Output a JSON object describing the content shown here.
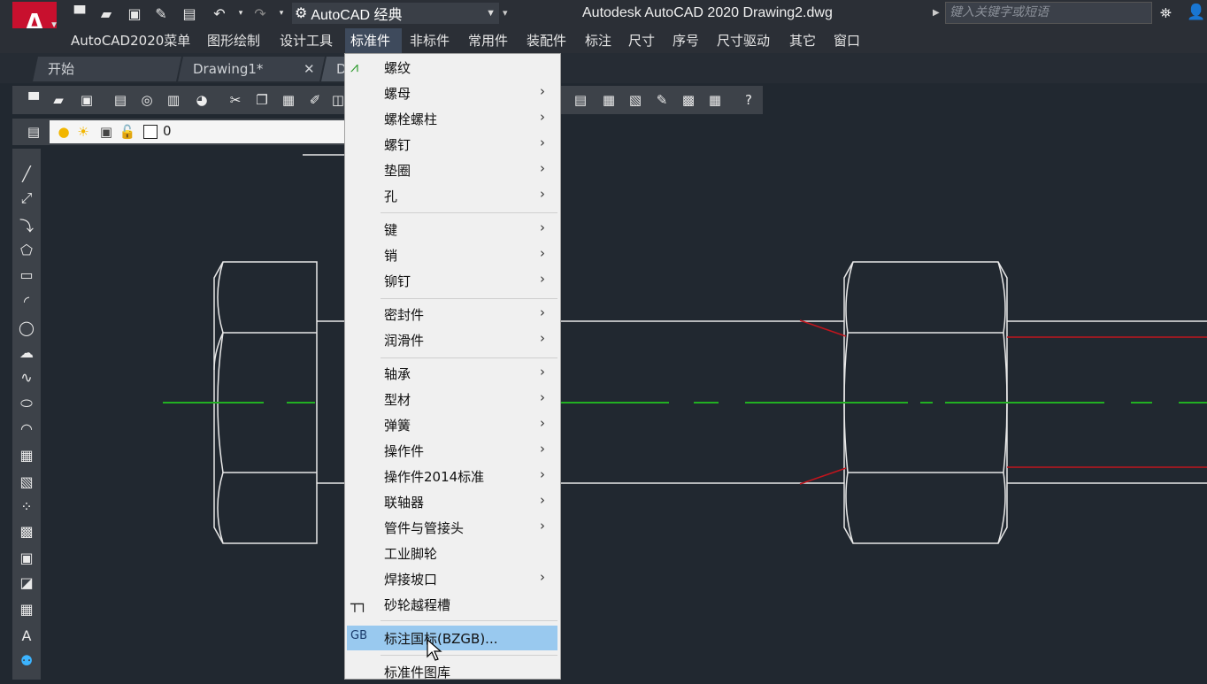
{
  "titlebar": {
    "logo": "A",
    "workspace": "AutoCAD 经典",
    "title": "Autodesk AutoCAD 2020    Drawing2.dwg",
    "search_placeholder": "键入关键字或短语"
  },
  "menubar": {
    "items": [
      "AutoCAD2020菜单",
      "图形绘制",
      "设计工具",
      "标准件",
      "非标件",
      "常用件",
      "装配件",
      "标注",
      "尺寸",
      "序号",
      "尺寸驱动",
      "其它",
      "窗口"
    ]
  },
  "tabs": [
    {
      "label": "开始"
    },
    {
      "label": "Drawing1*",
      "close": "✕"
    },
    {
      "label": "D"
    }
  ],
  "layer": {
    "name": "0"
  },
  "dropdown": {
    "items": [
      {
        "label": "螺纹",
        "submenu": false
      },
      {
        "label": "螺母",
        "submenu": true
      },
      {
        "label": "螺栓螺柱",
        "submenu": true
      },
      {
        "label": "螺钉",
        "submenu": true
      },
      {
        "label": "垫圈",
        "submenu": true
      },
      {
        "label": "孔",
        "submenu": true
      },
      {
        "label": "键",
        "submenu": true
      },
      {
        "label": "销",
        "submenu": true
      },
      {
        "label": "铆钉",
        "submenu": true
      },
      {
        "label": "密封件",
        "submenu": true
      },
      {
        "label": "润滑件",
        "submenu": true
      },
      {
        "label": "轴承",
        "submenu": true
      },
      {
        "label": "型材",
        "submenu": true
      },
      {
        "label": "弹簧",
        "submenu": true
      },
      {
        "label": "操作件",
        "submenu": true
      },
      {
        "label": "操作件2014标准",
        "submenu": true
      },
      {
        "label": "联轴器",
        "submenu": true
      },
      {
        "label": "管件与管接头",
        "submenu": true
      },
      {
        "label": "工业脚轮",
        "submenu": false
      },
      {
        "label": "焊接坡口",
        "submenu": true
      },
      {
        "label": "砂轮越程槽",
        "submenu": false
      },
      {
        "label": "标注国标(BZGB)...",
        "submenu": false,
        "highlighted": true
      },
      {
        "label": "标准件图库",
        "submenu": false
      }
    ],
    "arrow": "›"
  },
  "colors": {
    "accent_red": "#c8102e",
    "highlight": "#99c9ef",
    "centerline": "#22b022",
    "hidden_red": "#c0151d"
  }
}
